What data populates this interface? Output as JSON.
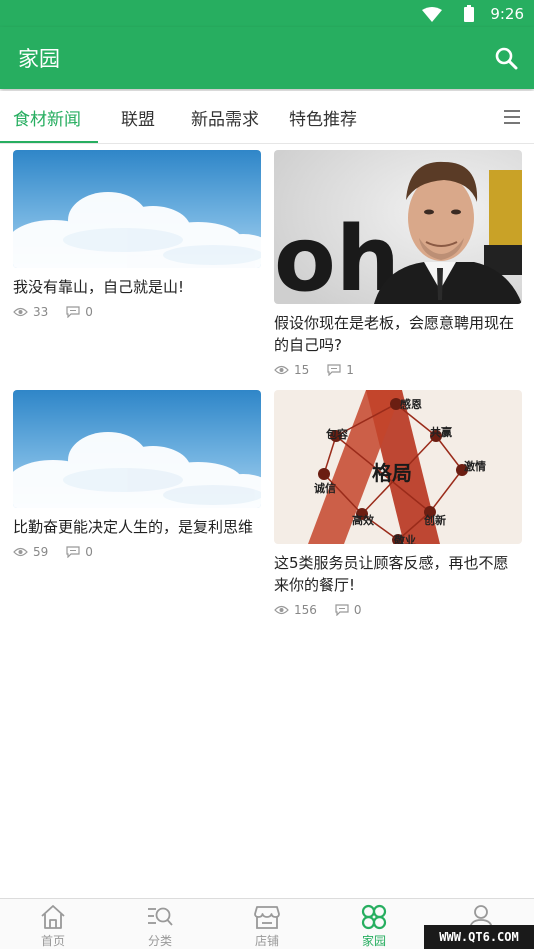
{
  "status_bar": {
    "time": "9:26"
  },
  "app_bar": {
    "title": "家园"
  },
  "tabs": [
    {
      "label": "食材新闻",
      "active": true
    },
    {
      "label": "联盟",
      "active": false
    },
    {
      "label": "新品需求",
      "active": false
    },
    {
      "label": "特色推荐",
      "active": false
    }
  ],
  "articles": [
    {
      "title": "我没有靠山，自己就是山!",
      "views": "33",
      "comments": "0",
      "image": "sky-clouds"
    },
    {
      "title": "假设你现在是老板，会愿意聘用现在的自己吗?",
      "views": "15",
      "comments": "1",
      "image": "man-portrait"
    },
    {
      "title": "比勤奋更能决定人生的，是复利思维",
      "views": "59",
      "comments": "0",
      "image": "sky-clouds"
    },
    {
      "title": "这5类服务员让顾客反感，再也不愿来你的餐厅!",
      "views": "156",
      "comments": "0",
      "image": "pattern-diagram"
    }
  ],
  "diagram_labels": {
    "center": "格局",
    "top": "感恩",
    "left1": "包容",
    "right1": "共赢",
    "left2": "诚信",
    "right2": "激情",
    "left3": "高效",
    "right3": "创新",
    "bottom": "敬业"
  },
  "bottom_nav": [
    {
      "label": "首页",
      "icon": "home-icon",
      "active": false
    },
    {
      "label": "分类",
      "icon": "category-search-icon",
      "active": false
    },
    {
      "label": "店铺",
      "icon": "store-icon",
      "active": false
    },
    {
      "label": "家园",
      "icon": "clover-icon",
      "active": true
    },
    {
      "label": "",
      "icon": "user-icon",
      "active": false
    }
  ],
  "watermark": "WWW.QT6.COM",
  "colors": {
    "primary": "#27ae60",
    "text": "#222222",
    "muted": "#888888"
  }
}
